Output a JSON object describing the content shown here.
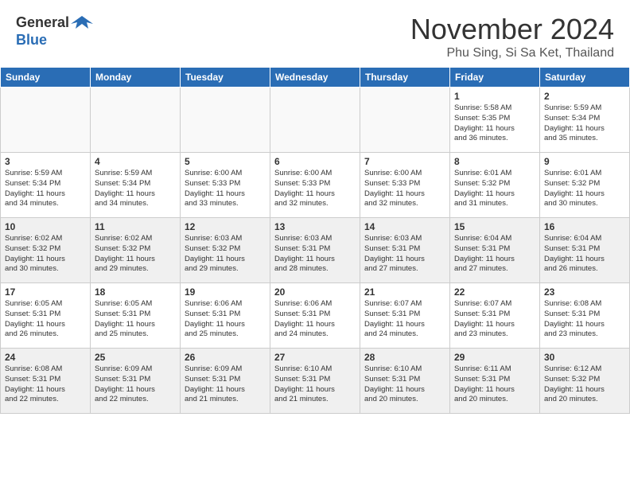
{
  "logo": {
    "general": "General",
    "blue": "Blue"
  },
  "title": "November 2024",
  "location": "Phu Sing, Si Sa Ket, Thailand",
  "days_header": [
    "Sunday",
    "Monday",
    "Tuesday",
    "Wednesday",
    "Thursday",
    "Friday",
    "Saturday"
  ],
  "weeks": [
    [
      {
        "num": "",
        "info": "",
        "empty": true
      },
      {
        "num": "",
        "info": "",
        "empty": true
      },
      {
        "num": "",
        "info": "",
        "empty": true
      },
      {
        "num": "",
        "info": "",
        "empty": true
      },
      {
        "num": "",
        "info": "",
        "empty": true
      },
      {
        "num": "1",
        "info": "Sunrise: 5:58 AM\nSunset: 5:35 PM\nDaylight: 11 hours\nand 36 minutes."
      },
      {
        "num": "2",
        "info": "Sunrise: 5:59 AM\nSunset: 5:34 PM\nDaylight: 11 hours\nand 35 minutes."
      }
    ],
    [
      {
        "num": "3",
        "info": "Sunrise: 5:59 AM\nSunset: 5:34 PM\nDaylight: 11 hours\nand 34 minutes."
      },
      {
        "num": "4",
        "info": "Sunrise: 5:59 AM\nSunset: 5:34 PM\nDaylight: 11 hours\nand 34 minutes."
      },
      {
        "num": "5",
        "info": "Sunrise: 6:00 AM\nSunset: 5:33 PM\nDaylight: 11 hours\nand 33 minutes."
      },
      {
        "num": "6",
        "info": "Sunrise: 6:00 AM\nSunset: 5:33 PM\nDaylight: 11 hours\nand 32 minutes."
      },
      {
        "num": "7",
        "info": "Sunrise: 6:00 AM\nSunset: 5:33 PM\nDaylight: 11 hours\nand 32 minutes."
      },
      {
        "num": "8",
        "info": "Sunrise: 6:01 AM\nSunset: 5:32 PM\nDaylight: 11 hours\nand 31 minutes."
      },
      {
        "num": "9",
        "info": "Sunrise: 6:01 AM\nSunset: 5:32 PM\nDaylight: 11 hours\nand 30 minutes."
      }
    ],
    [
      {
        "num": "10",
        "info": "Sunrise: 6:02 AM\nSunset: 5:32 PM\nDaylight: 11 hours\nand 30 minutes."
      },
      {
        "num": "11",
        "info": "Sunrise: 6:02 AM\nSunset: 5:32 PM\nDaylight: 11 hours\nand 29 minutes."
      },
      {
        "num": "12",
        "info": "Sunrise: 6:03 AM\nSunset: 5:32 PM\nDaylight: 11 hours\nand 29 minutes."
      },
      {
        "num": "13",
        "info": "Sunrise: 6:03 AM\nSunset: 5:31 PM\nDaylight: 11 hours\nand 28 minutes."
      },
      {
        "num": "14",
        "info": "Sunrise: 6:03 AM\nSunset: 5:31 PM\nDaylight: 11 hours\nand 27 minutes."
      },
      {
        "num": "15",
        "info": "Sunrise: 6:04 AM\nSunset: 5:31 PM\nDaylight: 11 hours\nand 27 minutes."
      },
      {
        "num": "16",
        "info": "Sunrise: 6:04 AM\nSunset: 5:31 PM\nDaylight: 11 hours\nand 26 minutes."
      }
    ],
    [
      {
        "num": "17",
        "info": "Sunrise: 6:05 AM\nSunset: 5:31 PM\nDaylight: 11 hours\nand 26 minutes."
      },
      {
        "num": "18",
        "info": "Sunrise: 6:05 AM\nSunset: 5:31 PM\nDaylight: 11 hours\nand 25 minutes."
      },
      {
        "num": "19",
        "info": "Sunrise: 6:06 AM\nSunset: 5:31 PM\nDaylight: 11 hours\nand 25 minutes."
      },
      {
        "num": "20",
        "info": "Sunrise: 6:06 AM\nSunset: 5:31 PM\nDaylight: 11 hours\nand 24 minutes."
      },
      {
        "num": "21",
        "info": "Sunrise: 6:07 AM\nSunset: 5:31 PM\nDaylight: 11 hours\nand 24 minutes."
      },
      {
        "num": "22",
        "info": "Sunrise: 6:07 AM\nSunset: 5:31 PM\nDaylight: 11 hours\nand 23 minutes."
      },
      {
        "num": "23",
        "info": "Sunrise: 6:08 AM\nSunset: 5:31 PM\nDaylight: 11 hours\nand 23 minutes."
      }
    ],
    [
      {
        "num": "24",
        "info": "Sunrise: 6:08 AM\nSunset: 5:31 PM\nDaylight: 11 hours\nand 22 minutes."
      },
      {
        "num": "25",
        "info": "Sunrise: 6:09 AM\nSunset: 5:31 PM\nDaylight: 11 hours\nand 22 minutes."
      },
      {
        "num": "26",
        "info": "Sunrise: 6:09 AM\nSunset: 5:31 PM\nDaylight: 11 hours\nand 21 minutes."
      },
      {
        "num": "27",
        "info": "Sunrise: 6:10 AM\nSunset: 5:31 PM\nDaylight: 11 hours\nand 21 minutes."
      },
      {
        "num": "28",
        "info": "Sunrise: 6:10 AM\nSunset: 5:31 PM\nDaylight: 11 hours\nand 20 minutes."
      },
      {
        "num": "29",
        "info": "Sunrise: 6:11 AM\nSunset: 5:31 PM\nDaylight: 11 hours\nand 20 minutes."
      },
      {
        "num": "30",
        "info": "Sunrise: 6:12 AM\nSunset: 5:32 PM\nDaylight: 11 hours\nand 20 minutes."
      }
    ]
  ]
}
